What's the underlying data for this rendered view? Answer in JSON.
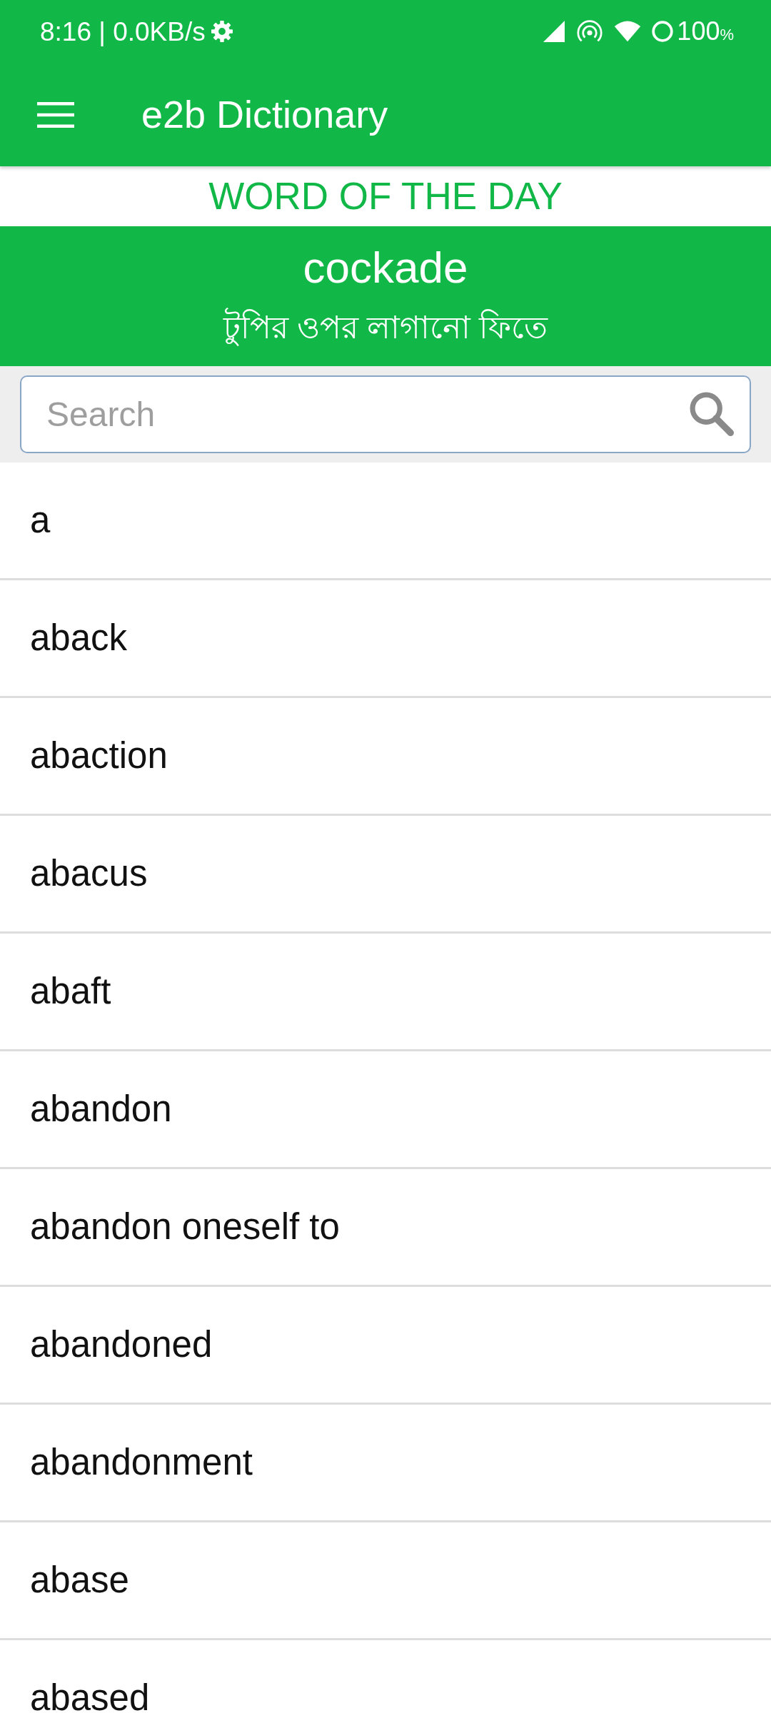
{
  "status_bar": {
    "text": "8:16 | 0.0KB/s",
    "battery_level": "100",
    "battery_unit": "%"
  },
  "app_bar": {
    "title": "e2b Dictionary"
  },
  "word_of_the_day": {
    "heading": "WORD OF THE DAY",
    "word": "cockade",
    "meaning": "টুপির ওপর লাগানো ফিতে"
  },
  "search": {
    "placeholder": "Search"
  },
  "words": [
    "a",
    "aback",
    "abaction",
    "abacus",
    "abaft",
    "abandon",
    "abandon oneself to",
    "abandoned",
    "abandonment",
    "abase",
    "abased"
  ]
}
